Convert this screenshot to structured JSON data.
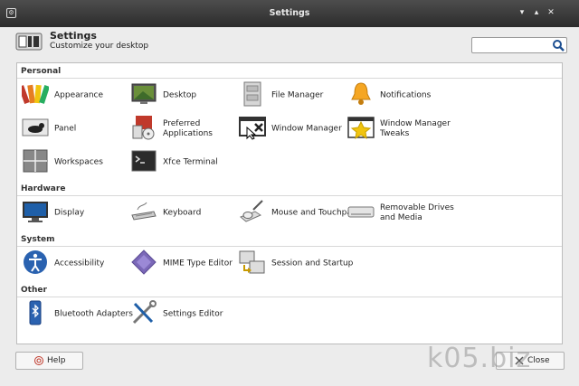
{
  "window": {
    "title": "Settings",
    "app_icon": "settings-app-icon",
    "minimize": "▾",
    "maximize": "▴",
    "close": "✕"
  },
  "header": {
    "title": "Settings",
    "subtitle": "Customize your desktop",
    "search_placeholder": ""
  },
  "sections": [
    {
      "title": "Personal",
      "items": [
        {
          "label": "Appearance",
          "icon": "appearance-icon"
        },
        {
          "label": "Desktop",
          "icon": "desktop-icon"
        },
        {
          "label": "File Manager",
          "icon": "file-manager-icon"
        },
        {
          "label": "Notifications",
          "icon": "notifications-icon"
        },
        {
          "label": "Panel",
          "icon": "panel-icon"
        },
        {
          "label": "Preferred Applications",
          "icon": "preferred-applications-icon"
        },
        {
          "label": "Window Manager",
          "icon": "window-manager-icon"
        },
        {
          "label": "Window Manager Tweaks",
          "icon": "window-manager-tweaks-icon"
        },
        {
          "label": "Workspaces",
          "icon": "workspaces-icon"
        },
        {
          "label": "Xfce Terminal",
          "icon": "terminal-icon"
        }
      ]
    },
    {
      "title": "Hardware",
      "items": [
        {
          "label": "Display",
          "icon": "display-icon"
        },
        {
          "label": "Keyboard",
          "icon": "keyboard-icon"
        },
        {
          "label": "Mouse and Touchpad",
          "icon": "mouse-icon"
        },
        {
          "label": "Removable Drives and Media",
          "icon": "removable-drive-icon"
        }
      ]
    },
    {
      "title": "System",
      "items": [
        {
          "label": "Accessibility",
          "icon": "accessibility-icon"
        },
        {
          "label": "MIME Type Editor",
          "icon": "mime-type-icon"
        },
        {
          "label": "Session and Startup",
          "icon": "session-startup-icon"
        }
      ]
    },
    {
      "title": "Other",
      "items": [
        {
          "label": "Bluetooth Adapters",
          "icon": "bluetooth-icon"
        },
        {
          "label": "Settings Editor",
          "icon": "settings-editor-icon"
        }
      ]
    }
  ],
  "footer": {
    "help_label": "Help",
    "close_label": "Close"
  },
  "watermark": "k05.biz"
}
